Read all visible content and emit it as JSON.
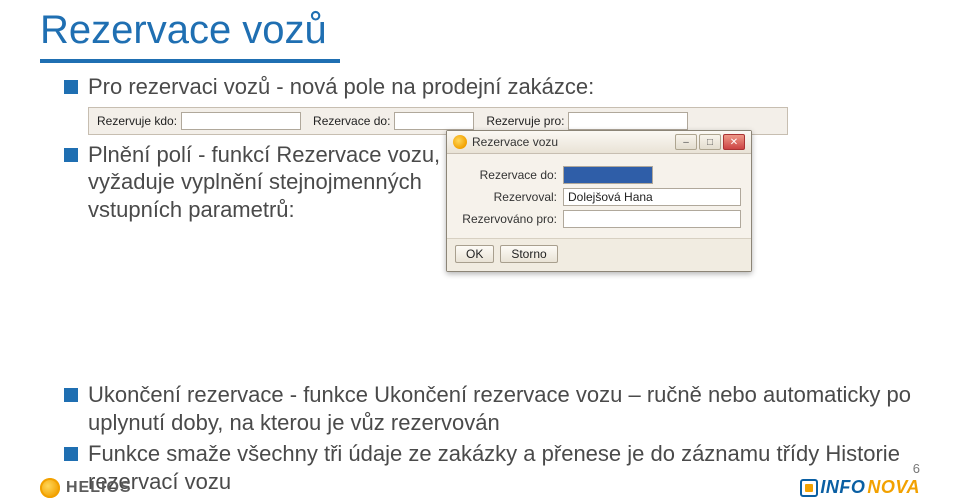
{
  "title": "Rezervace vozů",
  "bullets": {
    "b1": "Pro rezervaci vozů - nová pole na prodejní zakázce:",
    "b2": "Plnění polí - funkcí Rezervace vozu, vyžaduje vyplnění stejnojmenných vstupních parametrů:",
    "b3": "Ukončení rezervace - funkce Ukončení rezervace vozu – ručně nebo automaticky po uplynutí doby, na kterou je vůz rezervován",
    "b4": "Funkce smaže všechny tři údaje ze zakázky a přenese je do záznamu třídy Historie rezervací vozu"
  },
  "fieldbar": {
    "f1_label": "Rezervuje kdo:",
    "f1_value": "",
    "f2_label": "Rezervace do:",
    "f2_value": "",
    "f3_label": "Rezervuje pro:",
    "f3_value": ""
  },
  "dialog": {
    "title": "Rezervace vozu",
    "r1_label": "Rezervace do:",
    "r1_value": "",
    "r2_label": "Rezervoval:",
    "r2_value": "Dolejšová Hana",
    "r3_label": "Rezervováno pro:",
    "r3_value": "",
    "btn_ok": "OK",
    "btn_cancel": "Storno",
    "ctrl_min": "–",
    "ctrl_max": "□",
    "ctrl_close": "✕"
  },
  "footer": {
    "helios": "HELIOS",
    "info_left": "INFO",
    "info_right": "NOVA",
    "page": "6"
  }
}
